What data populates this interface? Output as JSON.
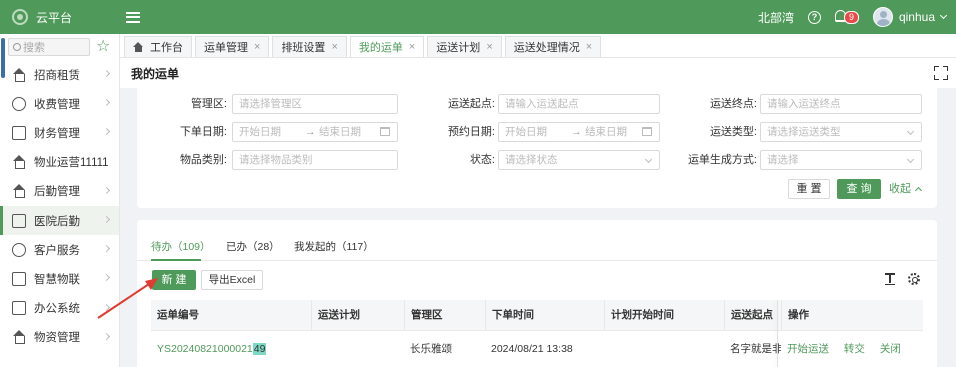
{
  "app": {
    "title": "云平台"
  },
  "topbar": {
    "location": "北部湾",
    "help": "?",
    "badge_count": "9",
    "username": "qinhua"
  },
  "sidebar": {
    "search_placeholder": "搜索",
    "items": [
      {
        "label": "招商租赁",
        "icon": "house-icon"
      },
      {
        "label": "收费管理",
        "icon": "coin-icon"
      },
      {
        "label": "财务管理",
        "icon": "ledger-icon"
      },
      {
        "label": "物业运营11111",
        "icon": "building-icon"
      },
      {
        "label": "后勤管理",
        "icon": "house-icon"
      },
      {
        "label": "医院后勤",
        "icon": "hospital-icon",
        "active": true
      },
      {
        "label": "客户服务",
        "icon": "user-icon"
      },
      {
        "label": "智慧物联",
        "icon": "iot-icon"
      },
      {
        "label": "办公系统",
        "icon": "office-icon"
      },
      {
        "label": "物资管理",
        "icon": "box-icon"
      }
    ]
  },
  "tabs": [
    {
      "label": "工作台",
      "closable": false
    },
    {
      "label": "运单管理",
      "closable": true
    },
    {
      "label": "排班设置",
      "closable": true
    },
    {
      "label": "我的运单",
      "closable": true,
      "active": true
    },
    {
      "label": "运送计划",
      "closable": true
    },
    {
      "label": "运送处理情况",
      "closable": true
    }
  ],
  "page": {
    "title": "我的运单"
  },
  "filters": {
    "mgmt_area": {
      "label": "管理区:",
      "placeholder": "请选择管理区"
    },
    "start_point": {
      "label": "运送起点:",
      "placeholder": "请输入运送起点"
    },
    "end_point": {
      "label": "运送终点:",
      "placeholder": "请输入运送终点"
    },
    "order_date": {
      "label": "下单日期:",
      "start": "开始日期",
      "end": "结束日期",
      "sep": "→"
    },
    "appoint_date": {
      "label": "预约日期:",
      "start": "开始日期",
      "end": "结束日期",
      "sep": "→"
    },
    "transport_type": {
      "label": "运送类型:",
      "placeholder": "请选择运送类型"
    },
    "item_category": {
      "label": "物品类别:",
      "placeholder": "请选择物品类别"
    },
    "status": {
      "label": "状态:",
      "placeholder": "请选择状态"
    },
    "generation_method": {
      "label": "运单生成方式:",
      "placeholder": "请选择"
    },
    "reset_label": "重 置",
    "query_label": "查 询",
    "collapse_label": "收起"
  },
  "list": {
    "tabs": [
      {
        "label": "待办（109）",
        "active": true
      },
      {
        "label": "已办（28）"
      },
      {
        "label": "我发起的（117）"
      }
    ],
    "new_label": "新 建",
    "export_label": "导出Excel",
    "columns": [
      "运单编号",
      "运送计划",
      "管理区",
      "下单时间",
      "计划开始时间",
      "运送起点",
      "操作"
    ],
    "rows": [
      {
        "order_no": "YS20240821000021",
        "order_no_highlight": "49",
        "plan": "",
        "area": "长乐雅颂",
        "order_time": "2024/08/21 13:38",
        "plan_start": "",
        "start_point": "名字就是非常",
        "actions": [
          "开始运送",
          "转交",
          "关闭"
        ]
      }
    ]
  },
  "colors": {
    "brand": "#4f9a5a",
    "annotation_arrow": "#e03c31",
    "highlight": "#7dd9c6"
  }
}
